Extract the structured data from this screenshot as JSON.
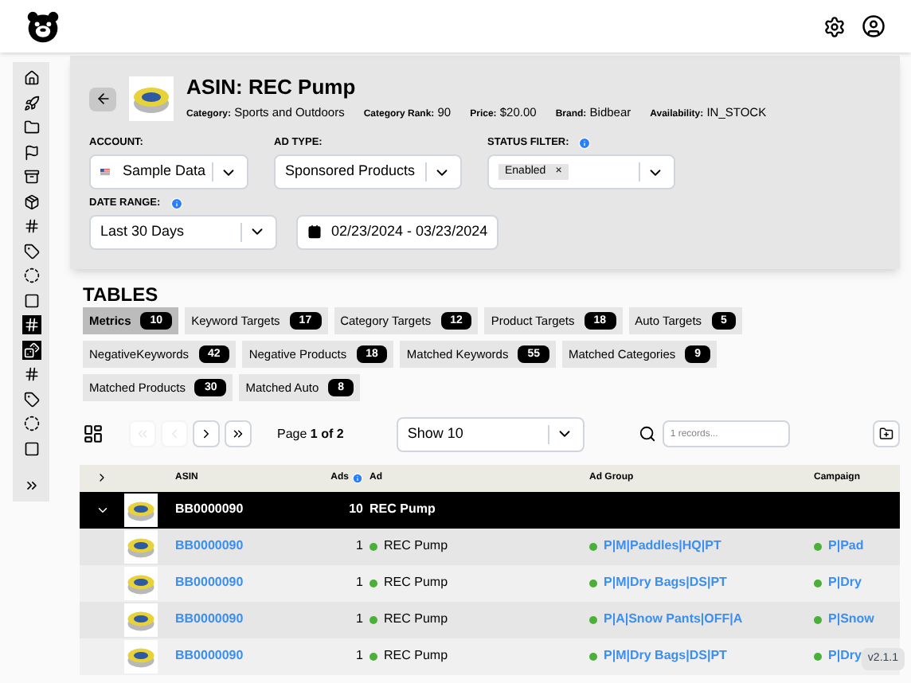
{
  "header": {
    "version": "v2.1.1"
  },
  "sidebar": {
    "items": [
      {
        "kind": "home",
        "selected": false
      },
      {
        "kind": "rocket",
        "selected": false
      },
      {
        "kind": "folder",
        "selected": false
      },
      {
        "kind": "flag",
        "selected": false
      },
      {
        "kind": "box",
        "selected": false
      },
      {
        "kind": "package",
        "selected": false
      },
      {
        "kind": "hash",
        "selected": false
      },
      {
        "kind": "tag",
        "selected": false
      },
      {
        "kind": "dashed",
        "selected": false
      },
      {
        "kind": "square",
        "selected": false
      },
      {
        "kind": "hash",
        "selected": true
      },
      {
        "kind": "dice",
        "selected": true
      },
      {
        "kind": "hash",
        "selected": false
      },
      {
        "kind": "tag",
        "selected": false
      },
      {
        "kind": "dashed",
        "selected": false
      },
      {
        "kind": "square",
        "selected": false
      },
      {
        "kind": "expand",
        "selected": false
      }
    ]
  },
  "product": {
    "title": "ASIN: REC Pump",
    "details": [
      {
        "label": "Category:",
        "value": "Sports and Outdoors"
      },
      {
        "label": "Category Rank:",
        "value": "90"
      },
      {
        "label": "Price:",
        "value": "$20.00"
      },
      {
        "label": "Brand:",
        "value": "Bidbear"
      },
      {
        "label": "Availability:",
        "value": "IN_STOCK"
      }
    ]
  },
  "filters": {
    "account": {
      "label": "ACCOUNT:",
      "value": "Sample Data"
    },
    "ad_type": {
      "label": "AD TYPE:",
      "value": "Sponsored Products"
    },
    "status_filter": {
      "label": "STATUS FILTER:",
      "chips": [
        "Enabled"
      ],
      "chip_remove": "×"
    },
    "date_range": {
      "label": "DATE RANGE:",
      "value": "Last 30 Days",
      "dates": "02/23/2024 - 03/23/2024"
    }
  },
  "tables": {
    "title": "TABLES",
    "tabs": [
      {
        "label": "Metrics",
        "count": "10",
        "selected": true
      },
      {
        "label": "Keyword Targets",
        "count": "17",
        "selected": false
      },
      {
        "label": "Category Targets",
        "count": "12",
        "selected": false
      },
      {
        "label": "Product Targets",
        "count": "18",
        "selected": false
      },
      {
        "label": "Auto Targets",
        "count": "5",
        "selected": false
      },
      {
        "label": "NegativeKeywords",
        "count": "42",
        "selected": false
      },
      {
        "label": "Negative Products",
        "count": "18",
        "selected": false
      },
      {
        "label": "Matched Keywords",
        "count": "55",
        "selected": false
      },
      {
        "label": "Matched Categories",
        "count": "9",
        "selected": false
      },
      {
        "label": "Matched Products",
        "count": "30",
        "selected": false
      },
      {
        "label": "Matched Auto",
        "count": "8",
        "selected": false
      }
    ]
  },
  "toolbar": {
    "pager_buttons": [
      {
        "kind": "first",
        "disabled": true
      },
      {
        "kind": "prev",
        "disabled": true
      },
      {
        "kind": "next",
        "disabled": false
      },
      {
        "kind": "last",
        "disabled": false
      }
    ],
    "page": "Page **1 of 2**",
    "page_size": "Show 10",
    "search_placeholder": "1 records..."
  },
  "table": {
    "columns": [
      "ASIN",
      "Ads",
      "Ad",
      "Ad Group",
      "Campaign"
    ],
    "group_row": {
      "expanded": true,
      "asin": "BB0000090",
      "ads": "10",
      "ad": "REC Pump"
    },
    "rows": [
      {
        "asin": "BB0000090",
        "ads": "1",
        "ad": "REC Pump",
        "ad_group": "P|M|Paddles|HQ|PT",
        "campaign": "P|Pad"
      },
      {
        "asin": "BB0000090",
        "ads": "1",
        "ad": "REC Pump",
        "ad_group": "P|M|Dry Bags|DS|PT",
        "campaign": "P|Dry"
      },
      {
        "asin": "BB0000090",
        "ads": "1",
        "ad": "REC Pump",
        "ad_group": "P|A|Snow Pants|OFF|A",
        "campaign": "P|Snow"
      },
      {
        "asin": "BB0000090",
        "ads": "1",
        "ad": "REC Pump",
        "ad_group": "P|M|Dry Bags|DS|PT",
        "campaign": "P|Dry"
      }
    ]
  }
}
